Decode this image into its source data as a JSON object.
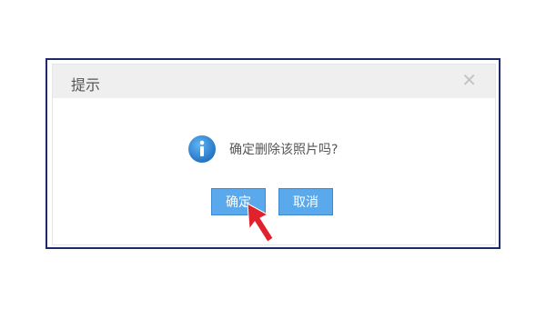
{
  "dialog": {
    "title": "提示",
    "close_icon": "close-icon",
    "message": "确定删除该照片吗?",
    "info_icon": "info-icon",
    "confirm_label": "确定",
    "cancel_label": "取消"
  },
  "colors": {
    "frame_border": "#1f2a6b",
    "header_bg": "#efefef",
    "button_bg": "#5aa9ec",
    "info_icon_blue": "#2f86d1",
    "pointer_red": "#e0222c"
  }
}
